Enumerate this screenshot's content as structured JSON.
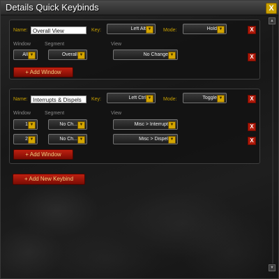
{
  "window": {
    "title": "Details Quick Keybinds",
    "close_glyph": "X"
  },
  "labels": {
    "name": "Name:",
    "key": "Key:",
    "mode": "Mode:",
    "window": "Window",
    "segment": "Segment",
    "view": "View"
  },
  "dropdown_arrow": "▼",
  "remove_glyph": "X",
  "keybinds": [
    {
      "name": "Overall View",
      "key": "Left Alt",
      "mode": "Hold",
      "add_window_label": "+ Add Window",
      "rows": [
        {
          "window": "All",
          "segment": "Overall",
          "view": "No Change"
        }
      ]
    },
    {
      "name": "Interrupts & Dispels",
      "key": "Left Ctrl",
      "mode": "Toggle",
      "add_window_label": "+ Add Window",
      "rows": [
        {
          "window": "1",
          "segment": "No Ch...",
          "view": "Misc > Interrupt"
        },
        {
          "window": "2",
          "segment": "No Ch...",
          "view": "Misc > Dispel"
        }
      ]
    }
  ],
  "add_keybind_label": "+ Add New Keybind",
  "scrollbar": {
    "up_glyph": "▲",
    "down_glyph": "▼"
  }
}
